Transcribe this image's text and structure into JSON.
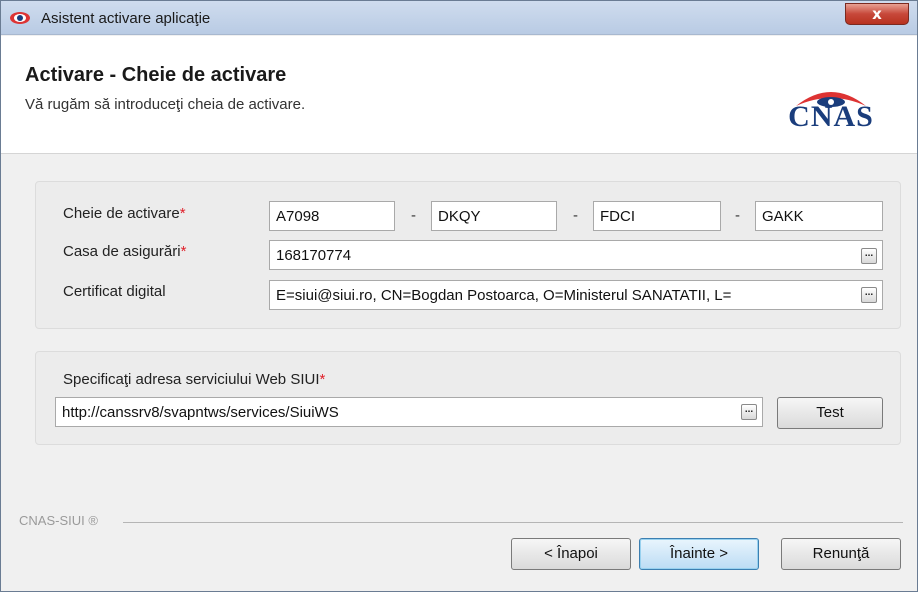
{
  "window": {
    "title": "Asistent activare aplicaţie",
    "close_glyph": "x",
    "app_icon": "eye-icon"
  },
  "header": {
    "title": "Activare - Cheie de activare",
    "subtitle": "Vă rugăm să introduceţi cheia de activare.",
    "logo_text": "CNAS"
  },
  "form": {
    "activation_key_label": "Cheie de activare",
    "activation_key_parts": [
      "A7098",
      "DKQY",
      "FDCI",
      "GAKK"
    ],
    "separator": "-",
    "insurance_house_label": "Casa de asigurări",
    "insurance_house_value": "168170774",
    "certificate_label": "Certificat digital",
    "certificate_value": "E=siui@siui.ro, CN=Bogdan Postoarca, O=Ministerul SANATATII, L=",
    "required_mark": "*",
    "ellipsis": "..."
  },
  "web_service": {
    "label": "Specificaţi adresa serviciului Web SIUI",
    "url_value": "http://canssrv8/svapntws/services/SiuiWS",
    "test_label": "Test"
  },
  "footer": {
    "brand": "CNAS-SIUI ®",
    "back_label": "< Înapoi",
    "next_label": "Înainte >",
    "cancel_label": "Renunţă"
  },
  "colors": {
    "required": "#e0202a",
    "logo_blue": "#1a3d7c",
    "close_red": "#c7483a"
  }
}
